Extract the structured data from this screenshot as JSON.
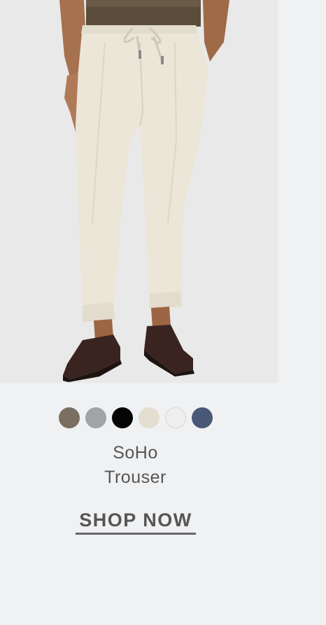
{
  "product": {
    "name_line1": "SoHo",
    "name_line2": "Trouser",
    "cta_label": "SHOP NOW",
    "image_alt": "Model wearing off-white drawstring trousers with dark brown loafers"
  },
  "swatches": [
    {
      "name": "Taupe",
      "color": "#7a6f60"
    },
    {
      "name": "Grey",
      "color": "#a0a3a8"
    },
    {
      "name": "Black",
      "color": "#050505"
    },
    {
      "name": "Stone",
      "color": "#e3ded0"
    },
    {
      "name": "Off-White",
      "color": "#f0eeec"
    },
    {
      "name": "Navy",
      "color": "#4a5878"
    }
  ],
  "colors": {
    "background": "#f0f1f3",
    "photo_background": "#e9e9e9",
    "text": "#555555"
  }
}
